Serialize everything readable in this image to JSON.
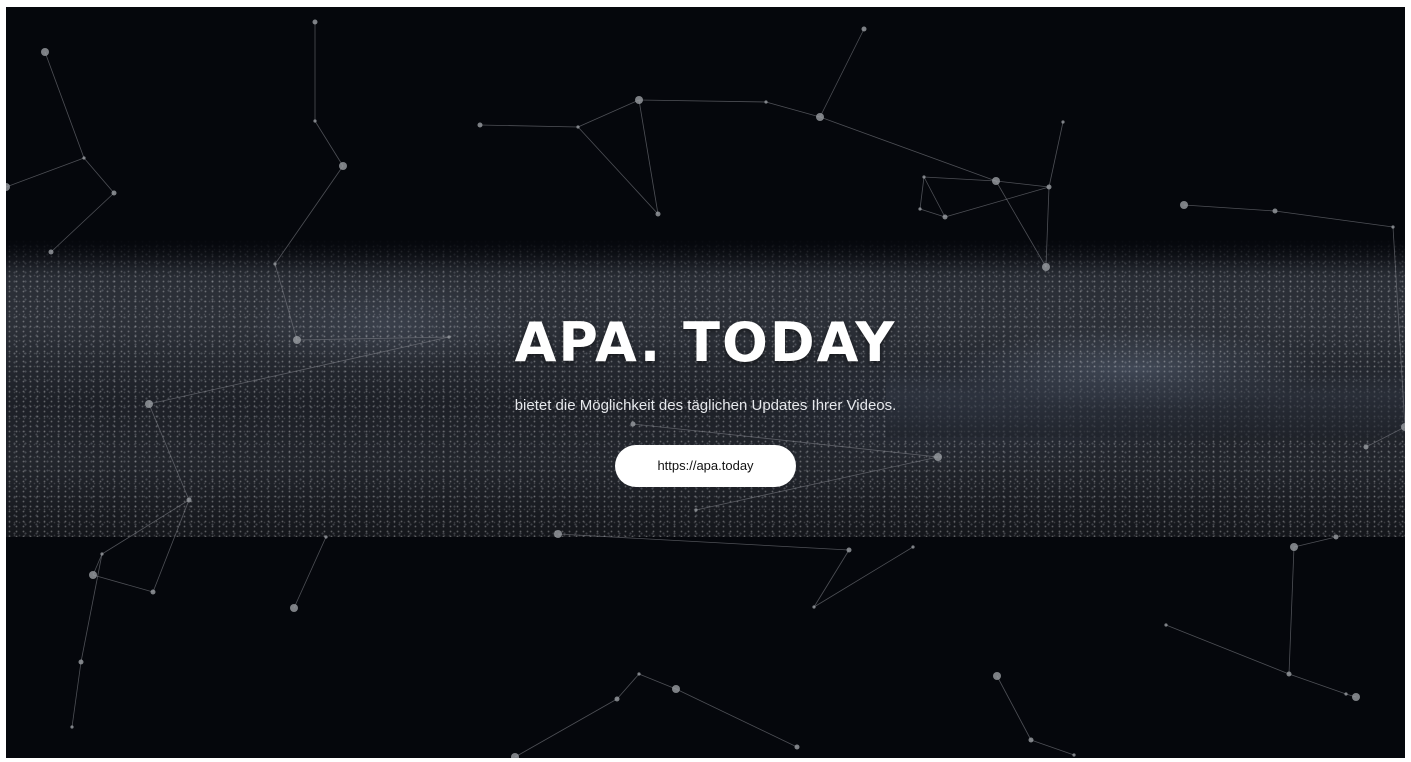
{
  "hero": {
    "title": "APA. TODAY",
    "subtitle": "bietet die Möglichkeit des täglichen Updates Ihrer Videos.",
    "cta_label": "https://apa.today"
  },
  "colors": {
    "background": "#05070c",
    "text": "#ffffff",
    "button_bg": "#ffffff",
    "button_text": "#111111",
    "network_lines": "#8a8d94"
  }
}
